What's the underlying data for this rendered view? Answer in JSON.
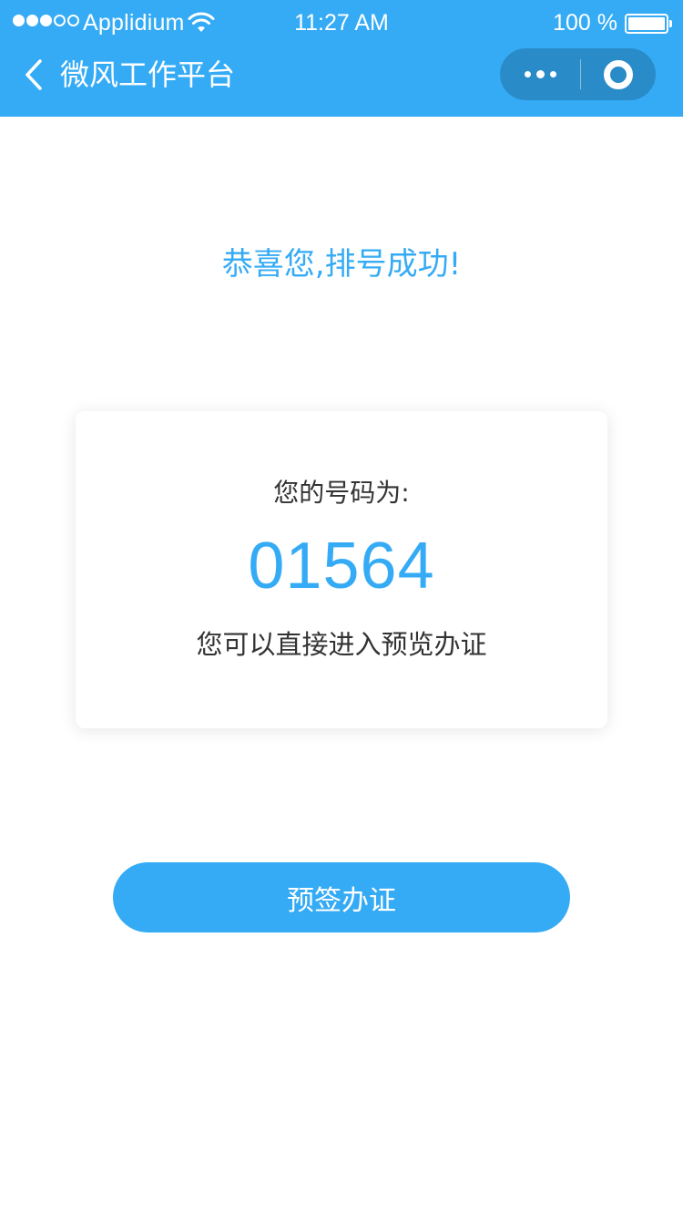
{
  "status_bar": {
    "carrier": "Applidium",
    "time": "11:27 AM",
    "battery": "100 %"
  },
  "nav": {
    "title": "微风工作平台",
    "back_icon": "chevron-left-icon",
    "more_icon": "more-dots-icon",
    "close_icon": "target-close-icon"
  },
  "main": {
    "success_message": "恭喜您,排号成功!",
    "card": {
      "label": "您的号码为:",
      "number": "01564",
      "hint": "您可以直接进入预览办证"
    },
    "button_label": "预签办证"
  },
  "colors": {
    "primary": "#35abf5",
    "capsule": "#2a8bc9",
    "text": "#333333"
  }
}
